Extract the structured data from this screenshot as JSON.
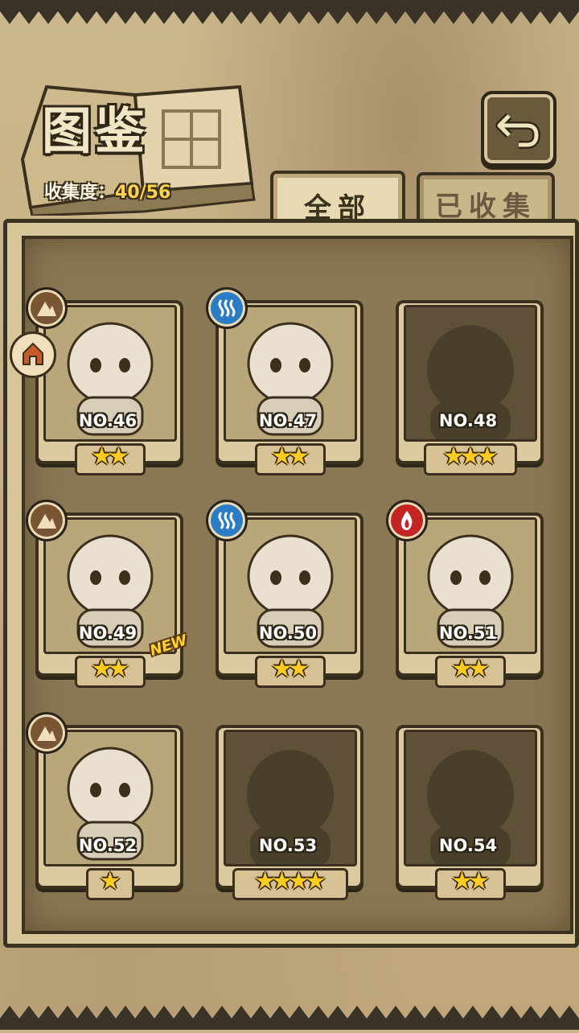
{
  "header": {
    "title": "图鉴",
    "collection_label": "收集度：",
    "collection_value": "40/56"
  },
  "tabs": [
    {
      "label": "全部",
      "active": true
    },
    {
      "label": "已收集",
      "active": false
    }
  ],
  "new_tag": "NEW",
  "cards": [
    {
      "no": "NO.46",
      "stars": "★★",
      "element": "earth",
      "owned": true
    },
    {
      "no": "NO.47",
      "stars": "★★",
      "element": "water",
      "owned": true
    },
    {
      "no": "NO.48",
      "stars": "★★★",
      "element": "",
      "owned": false
    },
    {
      "no": "NO.49",
      "stars": "★★",
      "element": "earth",
      "owned": true
    },
    {
      "no": "NO.50",
      "stars": "★★",
      "element": "water",
      "owned": true
    },
    {
      "no": "NO.51",
      "stars": "★★",
      "element": "fire",
      "owned": true
    },
    {
      "no": "NO.52",
      "stars": "★",
      "element": "earth",
      "owned": true
    },
    {
      "no": "NO.53",
      "stars": "★★★★",
      "element": "",
      "owned": false
    },
    {
      "no": "NO.54",
      "stars": "★★",
      "element": "",
      "owned": false
    }
  ],
  "colors": {
    "earth": "#7a5534",
    "water": "#2a7cc4",
    "fire": "#c42424",
    "star": "#ffcc22"
  }
}
